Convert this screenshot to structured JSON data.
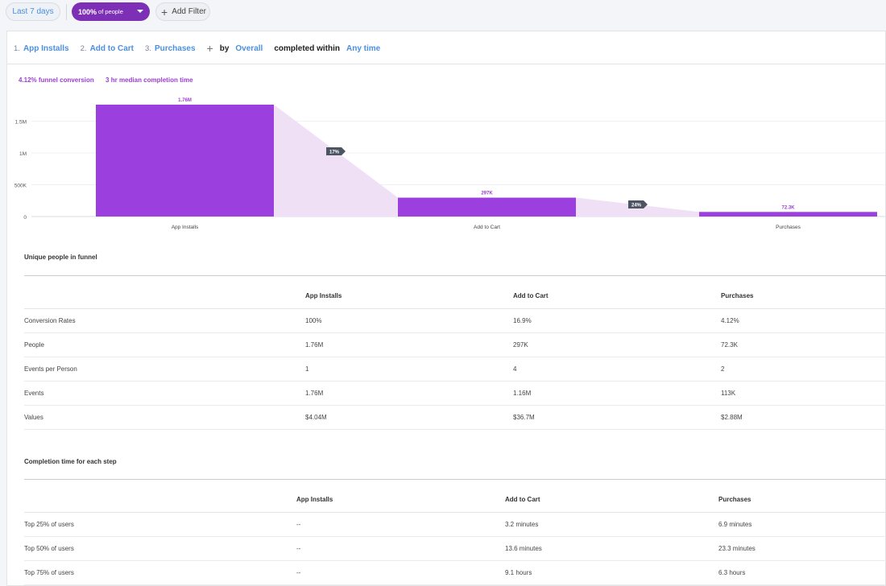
{
  "filters": {
    "date_range": "Last 7 days",
    "people_percent": "100%",
    "people_suffix": "of people",
    "add_filter": "Add Filter"
  },
  "query": {
    "steps": [
      {
        "num": "1.",
        "label": "App Installs"
      },
      {
        "num": "2.",
        "label": "Add to Cart"
      },
      {
        "num": "3.",
        "label": "Purchases"
      }
    ],
    "by_label": "by",
    "by_value": "Overall",
    "completed_label": "completed within",
    "completed_value": "Any time"
  },
  "summary": {
    "conversion": "4.12% funnel conversion",
    "median_time": "3 hr median completion time"
  },
  "colors": {
    "accent": "#9b3fd0",
    "bar": "#9b40df",
    "dropoff": "#efe0f6",
    "link": "#4a90e2",
    "badge": "#4d5563"
  },
  "chart_data": {
    "type": "bar",
    "categories": [
      "App Installs",
      "Add to Cart",
      "Purchases"
    ],
    "values": [
      1760000,
      297000,
      72300
    ],
    "data_labels": [
      "1.76M",
      "297K",
      "72.3K"
    ],
    "conversion_badges": [
      "17%",
      "24%"
    ],
    "yticks": [
      0,
      500000,
      1000000,
      1500000
    ],
    "ytick_labels": [
      "0",
      "500K",
      "1M",
      "1.5M"
    ],
    "ylim": [
      0,
      1760000
    ],
    "grid": true
  },
  "people_table": {
    "title": "Unique people in funnel",
    "headers": [
      "",
      "App Installs",
      "Add to Cart",
      "Purchases"
    ],
    "rows": [
      [
        "Conversion Rates",
        "100%",
        "16.9%",
        "4.12%"
      ],
      [
        "People",
        "1.76M",
        "297K",
        "72.3K"
      ],
      [
        "Events per Person",
        "1",
        "4",
        "2"
      ],
      [
        "Events",
        "1.76M",
        "1.16M",
        "113K"
      ],
      [
        "Values",
        "$4.04M",
        "$36.7M",
        "$2.88M"
      ]
    ]
  },
  "completion_table": {
    "title": "Completion time for each step",
    "headers": [
      "",
      "App Installs",
      "Add to Cart",
      "Purchases"
    ],
    "rows": [
      [
        "Top 25% of users",
        "--",
        "3.2 minutes",
        "6.9 minutes"
      ],
      [
        "Top 50% of users",
        "--",
        "13.6 minutes",
        "23.3 minutes"
      ],
      [
        "Top 75% of users",
        "--",
        "9.1 hours",
        "6.3 hours"
      ]
    ]
  }
}
